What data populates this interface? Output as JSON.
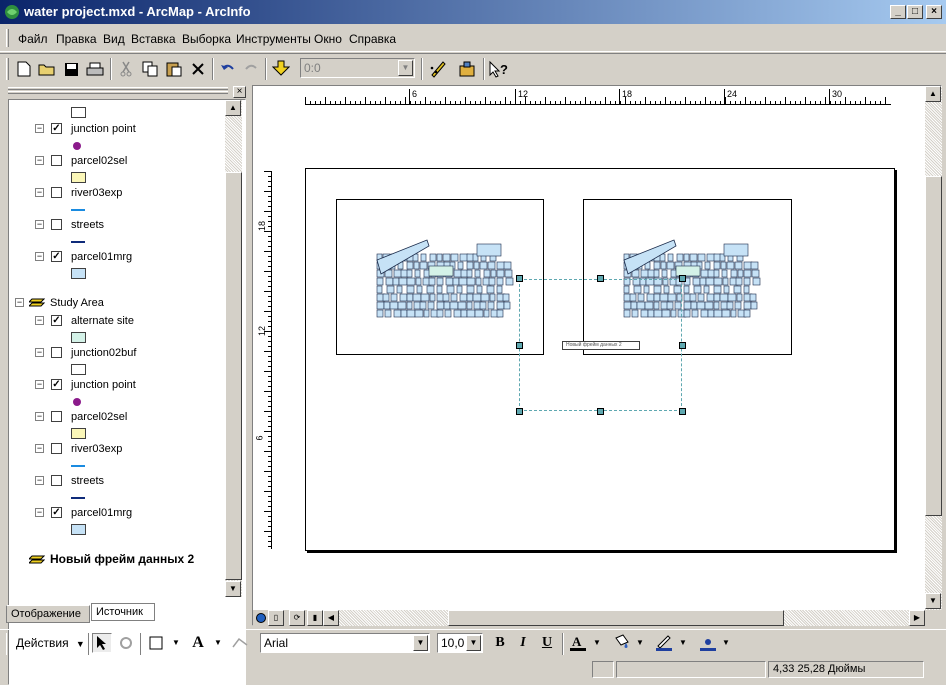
{
  "window": {
    "title": "water project.mxd - ArcMap - ArcInfo",
    "minimize": "_",
    "maximize": "□",
    "close": "×"
  },
  "menu": [
    "Файл",
    "Правка",
    "Вид",
    "Вставка",
    "Выборка",
    "Инструменты",
    "Окно",
    "Справка"
  ],
  "toolbar": {
    "scale_value": "0:0"
  },
  "toc": {
    "top_items": [
      {
        "label": "junction point",
        "checked": true,
        "symbol": "point",
        "color": "#8b1a8b"
      },
      {
        "label": "parcel02sel",
        "checked": false,
        "symbol": "fill",
        "color": "#fbf7b8"
      },
      {
        "label": "river03exp",
        "checked": false,
        "symbol": "line",
        "color": "#1a8be0"
      },
      {
        "label": "streets",
        "checked": false,
        "symbol": "line",
        "color": "#0f2b7a"
      },
      {
        "label": "parcel01mrg",
        "checked": true,
        "symbol": "fill",
        "color": "#c6e2f6"
      }
    ],
    "group_label": "Study Area",
    "group_items": [
      {
        "label": "alternate site",
        "checked": true,
        "symbol": "fill",
        "color": "#d4f2e8"
      },
      {
        "label": "junction02buf",
        "checked": false,
        "symbol": "fill",
        "color": "#ffffff"
      },
      {
        "label": "junction point",
        "checked": true,
        "symbol": "point",
        "color": "#8b1a8b"
      },
      {
        "label": "parcel02sel",
        "checked": false,
        "symbol": "fill",
        "color": "#fbf7b8"
      },
      {
        "label": "river03exp",
        "checked": false,
        "symbol": "line",
        "color": "#1a8be0"
      },
      {
        "label": "streets",
        "checked": false,
        "symbol": "line",
        "color": "#0f2b7a"
      },
      {
        "label": "parcel01mrg",
        "checked": true,
        "symbol": "fill",
        "color": "#c6e2f6"
      }
    ],
    "new_frame_label": "Новый фрейм данных 2",
    "tabs": [
      "Отображение",
      "Источник"
    ]
  },
  "layout": {
    "ruler_h_labels": [
      "6",
      "12",
      "18",
      "24",
      "30"
    ],
    "ruler_v_labels": [
      "18",
      "12",
      "6"
    ],
    "selected_frame_label": "Новый фрейм данных 2"
  },
  "drawbar": {
    "actions_label": "Действия",
    "font_name": "Arial",
    "font_size": "10,0",
    "bold": "B",
    "italic": "I",
    "underline": "U"
  },
  "status": {
    "coords": "4,33  25,28 Дюймы"
  }
}
